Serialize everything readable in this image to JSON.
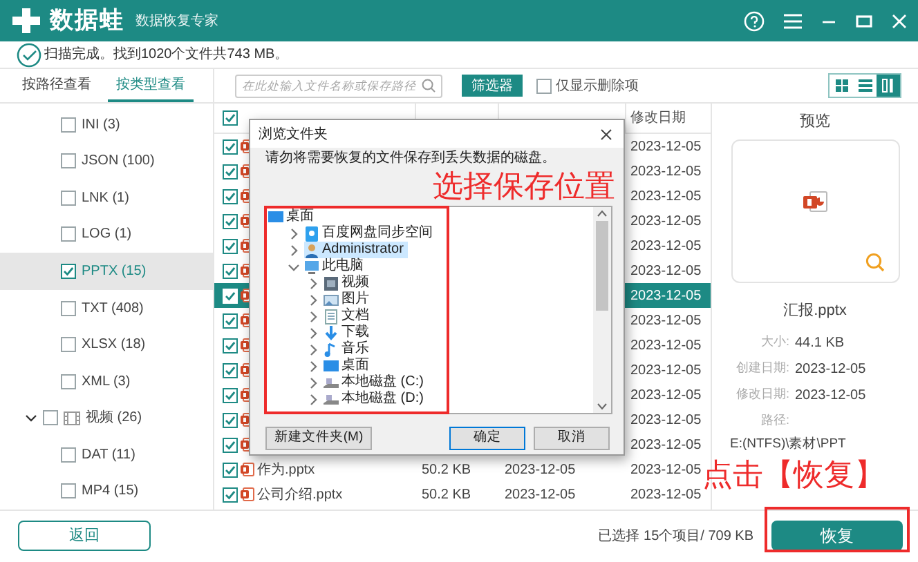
{
  "app": {
    "name": "数据蛙",
    "subtitle": "数据恢复专家"
  },
  "scan_status": "扫描完成。找到1020个文件共743 MB。",
  "view_tabs": [
    {
      "label": "按路径查看",
      "selected": false
    },
    {
      "label": "按类型查看",
      "selected": true
    }
  ],
  "search": {
    "placeholder": "在此处输入文件名称或保存路径"
  },
  "filter_button": "筛选器",
  "deleted_only": {
    "label": "仅显示删除项",
    "checked": false
  },
  "view_modes": [
    {
      "kind": "grid",
      "selected": false
    },
    {
      "kind": "list",
      "selected": false
    },
    {
      "kind": "preview",
      "selected": true
    }
  ],
  "file_types": [
    {
      "label": "INI (3)",
      "checked": false,
      "selected": false
    },
    {
      "label": "JSON (100)",
      "checked": false,
      "selected": false
    },
    {
      "label": "LNK (1)",
      "checked": false,
      "selected": false
    },
    {
      "label": "LOG (1)",
      "checked": false,
      "selected": false
    },
    {
      "label": "PPTX (15)",
      "checked": true,
      "selected": true
    },
    {
      "label": "TXT (408)",
      "checked": false,
      "selected": false
    },
    {
      "label": "XLSX (18)",
      "checked": false,
      "selected": false
    },
    {
      "label": "XML (3)",
      "checked": false,
      "selected": false
    },
    {
      "label": "视频 (26)",
      "checked": false,
      "selected": false,
      "expanded": true,
      "children": [
        {
          "label": "DAT (11)",
          "checked": false,
          "selected": false
        },
        {
          "label": "MP4 (15)",
          "checked": false,
          "selected": false
        }
      ]
    }
  ],
  "table": {
    "all_checked": true,
    "columns": [
      "修改日期"
    ],
    "rows": [
      {
        "checked": true,
        "selected": false,
        "modified": "2023-12-05"
      },
      {
        "checked": true,
        "selected": false,
        "modified": "2023-12-05"
      },
      {
        "checked": true,
        "selected": false,
        "modified": "2023-12-05"
      },
      {
        "checked": true,
        "selected": false,
        "modified": "2023-12-05"
      },
      {
        "checked": true,
        "selected": false,
        "modified": "2023-12-05"
      },
      {
        "checked": true,
        "selected": false,
        "modified": "2023-12-05"
      },
      {
        "checked": true,
        "selected": true,
        "modified": "2023-12-05"
      },
      {
        "checked": true,
        "selected": false,
        "modified": "2023-12-05"
      },
      {
        "checked": true,
        "selected": false,
        "modified": "2023-12-05"
      },
      {
        "checked": true,
        "selected": false,
        "modified": "2023-12-05"
      },
      {
        "checked": true,
        "selected": false,
        "modified": "2023-12-05"
      },
      {
        "checked": true,
        "selected": false,
        "modified": "2023-12-05"
      },
      {
        "checked": true,
        "selected": false,
        "modified": "2023-12-05"
      },
      {
        "checked": true,
        "selected": false,
        "name": "作为.pptx",
        "size": "50.2 KB",
        "created": "2023-12-05",
        "modified": "2023-12-05"
      },
      {
        "checked": true,
        "selected": false,
        "name": "公司介绍.pptx",
        "size": "50.2 KB",
        "created": "2023-12-05",
        "modified": "2023-12-05"
      }
    ]
  },
  "preview": {
    "title": "预览",
    "file_name": "汇报.pptx",
    "details": [
      {
        "label": "大小:",
        "value": "44.1 KB"
      },
      {
        "label": "创建日期:",
        "value": "2023-12-05"
      },
      {
        "label": "修改日期:",
        "value": "2023-12-05"
      }
    ],
    "path_label": "路径:",
    "path": "E:(NTFS)\\素材\\PPT"
  },
  "dialog": {
    "title": "浏览文件夹",
    "message": "请勿将需要恢复的文件保存到丢失数据的磁盘。",
    "tree": [
      {
        "label": "桌面",
        "kind": "desktop",
        "selected": false,
        "children": [
          {
            "label": "百度网盘同步空间",
            "kind": "cloud",
            "expanded": false,
            "selected": false
          },
          {
            "label": "Administrator",
            "kind": "user",
            "expanded": false,
            "selected": true
          },
          {
            "label": "此电脑",
            "kind": "computer",
            "expanded": true,
            "selected": false,
            "children": [
              {
                "label": "视频",
                "kind": "video",
                "expanded": false,
                "selected": false
              },
              {
                "label": "图片",
                "kind": "pictures",
                "expanded": false,
                "selected": false
              },
              {
                "label": "文档",
                "kind": "documents",
                "expanded": false,
                "selected": false
              },
              {
                "label": "下载",
                "kind": "downloads",
                "expanded": false,
                "selected": false
              },
              {
                "label": "音乐",
                "kind": "music",
                "expanded": false,
                "selected": false
              },
              {
                "label": "桌面",
                "kind": "desktop",
                "expanded": false,
                "selected": false
              },
              {
                "label": "本地磁盘 (C:)",
                "kind": "drive",
                "expanded": false,
                "selected": false
              },
              {
                "label": "本地磁盘 (D:)",
                "kind": "drive",
                "expanded": false,
                "selected": false
              }
            ]
          }
        ]
      }
    ],
    "buttons": [
      {
        "label": "新建文件夹(M)",
        "kind": "secondary"
      },
      {
        "label": "确定",
        "kind": "default"
      },
      {
        "label": "取消",
        "kind": "secondary"
      }
    ]
  },
  "annotations": [
    {
      "text": "选择保存位置"
    },
    {
      "text": "点击【恢复】"
    }
  ],
  "footer": {
    "back_button": "返回",
    "selection_summary": "已选择 15个项目/ 709 KB",
    "recover_button": "恢复"
  }
}
